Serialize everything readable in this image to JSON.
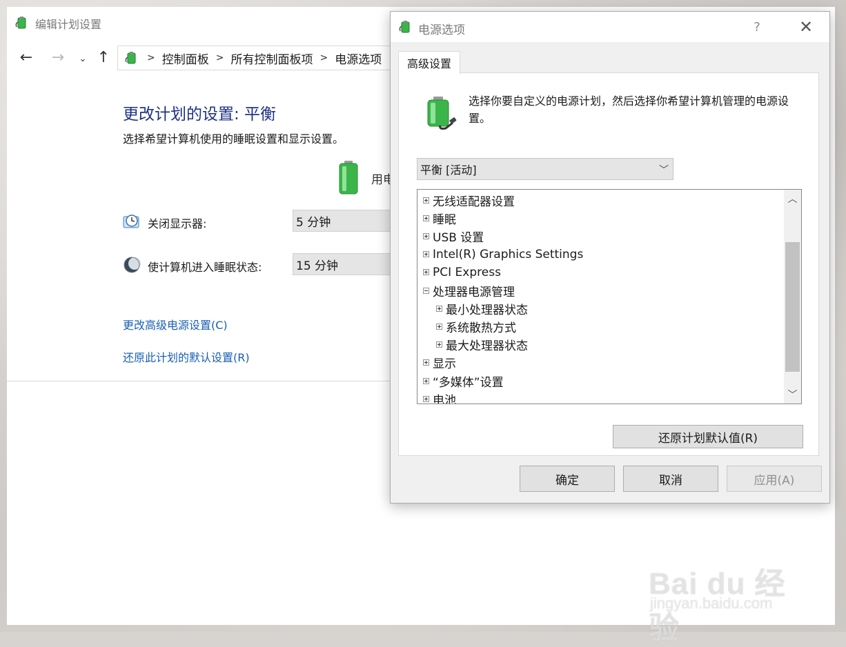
{
  "control_panel": {
    "window_title": "编辑计划设置",
    "breadcrumbs": [
      "控制面板",
      "所有控制面板项",
      "电源选项"
    ],
    "heading": "更改计划的设置: 平衡",
    "subtitle": "选择希望计算机使用的睡眠设置和显示设置。",
    "column_label": "用电",
    "settings": [
      {
        "label": "关闭显示器:",
        "value": "5 分钟",
        "icon": "clock-monitor-icon"
      },
      {
        "label": "使计算机进入睡眠状态:",
        "value": "15 分钟",
        "icon": "moon-sleep-icon"
      }
    ],
    "links": {
      "advanced": "更改高级电源设置(C)",
      "restore": "还原此计划的默认设置(R)"
    }
  },
  "dialog": {
    "title": "电源选项",
    "help_glyph": "?",
    "close_glyph": "✕",
    "tab": "高级设置",
    "intro": "选择你要自定义的电源计划，然后选择你希望计算机管理的电源设置。",
    "plan_selected": "平衡 [活动]",
    "tree": [
      {
        "label": "无线适配器设置",
        "level": 0,
        "expanded": false
      },
      {
        "label": "睡眠",
        "level": 0,
        "expanded": false
      },
      {
        "label": "USB 设置",
        "level": 0,
        "expanded": false
      },
      {
        "label": "Intel(R) Graphics Settings",
        "level": 0,
        "expanded": false
      },
      {
        "label": "PCI Express",
        "level": 0,
        "expanded": false
      },
      {
        "label": "处理器电源管理",
        "level": 0,
        "expanded": true
      },
      {
        "label": "最小处理器状态",
        "level": 1,
        "expanded": false
      },
      {
        "label": "系统散热方式",
        "level": 1,
        "expanded": false
      },
      {
        "label": "最大处理器状态",
        "level": 1,
        "expanded": false
      },
      {
        "label": "显示",
        "level": 0,
        "expanded": false
      },
      {
        "label": "“多媒体”设置",
        "level": 0,
        "expanded": false
      },
      {
        "label": "电池",
        "level": 0,
        "expanded": false
      }
    ],
    "restore_plan_button": "还原计划默认值(R)",
    "ok_button": "确定",
    "cancel_button": "取消",
    "apply_button": "应用(A)"
  },
  "watermark": {
    "brand": "Bai du 经验",
    "url": "jingyan.baidu.com"
  },
  "colors": {
    "heading_blue": "#1e3287",
    "link_blue": "#1a5fb4",
    "battery_green": "#3bb54a"
  }
}
